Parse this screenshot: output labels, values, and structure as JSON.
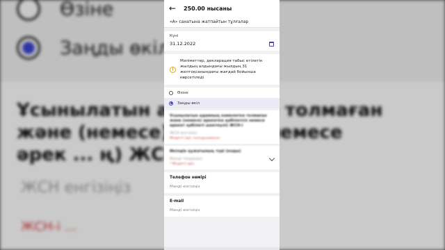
{
  "background": {
    "radio_option_1": "Өзіне",
    "radio_option_2": "Заңды өкіл",
    "blurred_line_1": "Ұсынылатын адам ... тке толмаған",
    "blurred_line_2": "және (немесе) әр ... сіз немесе",
    "blurred_line_3": "әрек ... ң) ЖСН-і",
    "blurred_input": "ЖСН енгізіңіз",
    "blurred_error": "ЖСН-і ..."
  },
  "header": {
    "title": "250.00 нысаны",
    "subtitle": "«А» санатына жатпайтын тұлғалар"
  },
  "date_field": {
    "label": "Күні",
    "value": "31.12.2022"
  },
  "info": {
    "text": "Мәліметтер, декларация табыс етілетін жылдың алдындағы жылдың 31 желтоқсанындағы жағдай бойынша көрсетіледі"
  },
  "radios": [
    {
      "label": "Өзіне",
      "selected": false
    },
    {
      "label": "Заңды өкіл",
      "selected": true
    }
  ],
  "blurred_block_1": {
    "line1": "Ұсынылатын адамның кәмелетке толмаған",
    "line2": "және (немесе) әрекетке қабілетсіз немесе",
    "line3": "әрекет қабілеті шектеулі) ЖСН-і",
    "input": "ЖСН енгізіңіз",
    "error": "Міндетті өріс толтырылмаған"
  },
  "blurred_block_2": {
    "line1": "Өкілдік құжатының түрі (коды)",
    "input": "Мәнді таңдаңыз",
    "error": "* Міндетті өріс"
  },
  "phone_field": {
    "label": "Телефон нөмірі",
    "placeholder": "Мәнді енгізіңіз"
  },
  "email_field": {
    "label": "E-mail",
    "placeholder": "Мәнді енгізіңіз"
  },
  "colors": {
    "accent": "#3b41c9",
    "warning": "#d9a521",
    "error": "#d23a3a"
  },
  "icons": [
    "back-arrow-icon",
    "calendar-icon",
    "warning-icon",
    "chevron-down-icon"
  ]
}
